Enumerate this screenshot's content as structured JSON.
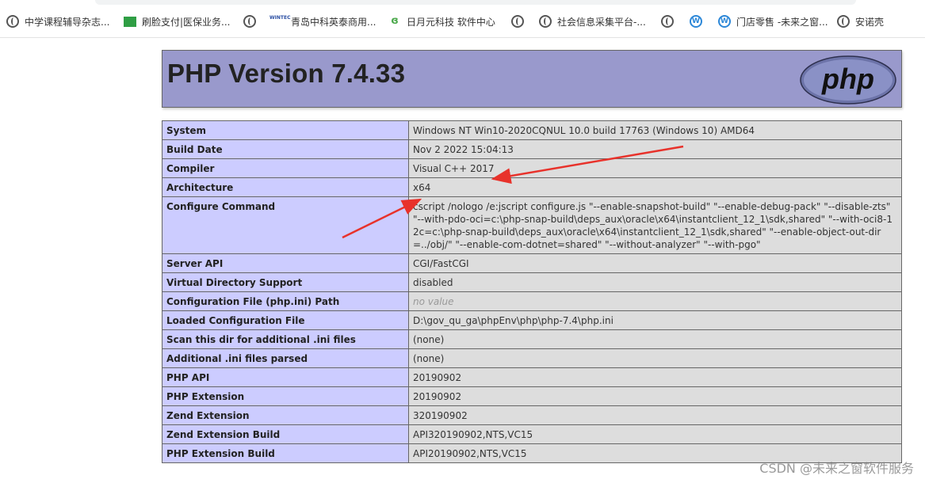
{
  "bookmarks": [
    {
      "label": "中学课程辅导杂志...",
      "icon": "globe-icon"
    },
    {
      "label": "刷脸支付|医保业务...",
      "icon": "green-square-icon"
    },
    {
      "label": "",
      "icon": "globe-icon"
    },
    {
      "label": "青岛中科英泰商用...",
      "icon": "wintec-logo-icon"
    },
    {
      "label": "日月元科技 软件中心",
      "icon": "leaf-icon"
    },
    {
      "label": "",
      "icon": "globe-icon"
    },
    {
      "label": "社会信息采集平台-...",
      "icon": "globe-icon"
    },
    {
      "label": "",
      "icon": "globe-icon"
    },
    {
      "label": "",
      "icon": "w-circle-icon"
    },
    {
      "label": "门店零售 -未来之窗...",
      "icon": "w-circle-icon"
    },
    {
      "label": "",
      "icon": "globe-icon"
    },
    {
      "label": "安诺壳",
      "icon": "globe-icon"
    }
  ],
  "header": {
    "title": "PHP Version 7.4.33",
    "logo_text": "php"
  },
  "rows": [
    {
      "name": "System",
      "value": "Windows NT Win10-2020CQNUL 10.0 build 17763 (Windows 10) AMD64"
    },
    {
      "name": "Build Date",
      "value": "Nov 2 2022 15:04:13"
    },
    {
      "name": "Compiler",
      "value": "Visual C++ 2017"
    },
    {
      "name": "Architecture",
      "value": "x64"
    },
    {
      "name": "Configure Command",
      "value": "cscript /nologo /e:jscript configure.js \"--enable-snapshot-build\" \"--enable-debug-pack\" \"--disable-zts\" \"--with-pdo-oci=c:\\php-snap-build\\deps_aux\\oracle\\x64\\instantclient_12_1\\sdk,shared\" \"--with-oci8-12c=c:\\php-snap-build\\deps_aux\\oracle\\x64\\instantclient_12_1\\sdk,shared\" \"--enable-object-out-dir=../obj/\" \"--enable-com-dotnet=shared\" \"--without-analyzer\" \"--with-pgo\""
    },
    {
      "name": "Server API",
      "value": "CGI/FastCGI"
    },
    {
      "name": "Virtual Directory Support",
      "value": "disabled"
    },
    {
      "name": "Configuration File (php.ini) Path",
      "value": "no value"
    },
    {
      "name": "Loaded Configuration File",
      "value": "D:\\gov_qu_ga\\phpEnv\\php\\php-7.4\\php.ini"
    },
    {
      "name": "Scan this dir for additional .ini files",
      "value": "(none)"
    },
    {
      "name": "Additional .ini files parsed",
      "value": "(none)"
    },
    {
      "name": "PHP API",
      "value": "20190902"
    },
    {
      "name": "PHP Extension",
      "value": "20190902"
    },
    {
      "name": "Zend Extension",
      "value": "320190902"
    },
    {
      "name": "Zend Extension Build",
      "value": "API320190902,NTS,VC15"
    },
    {
      "name": "PHP Extension Build",
      "value": "API20190902,NTS,VC15"
    }
  ],
  "watermark": "CSDN @未来之窗软件服务",
  "colors": {
    "header_bg": "#9999cc",
    "label_bg": "#ccccff",
    "value_bg": "#dddddd",
    "arrow": "#e8322b"
  }
}
